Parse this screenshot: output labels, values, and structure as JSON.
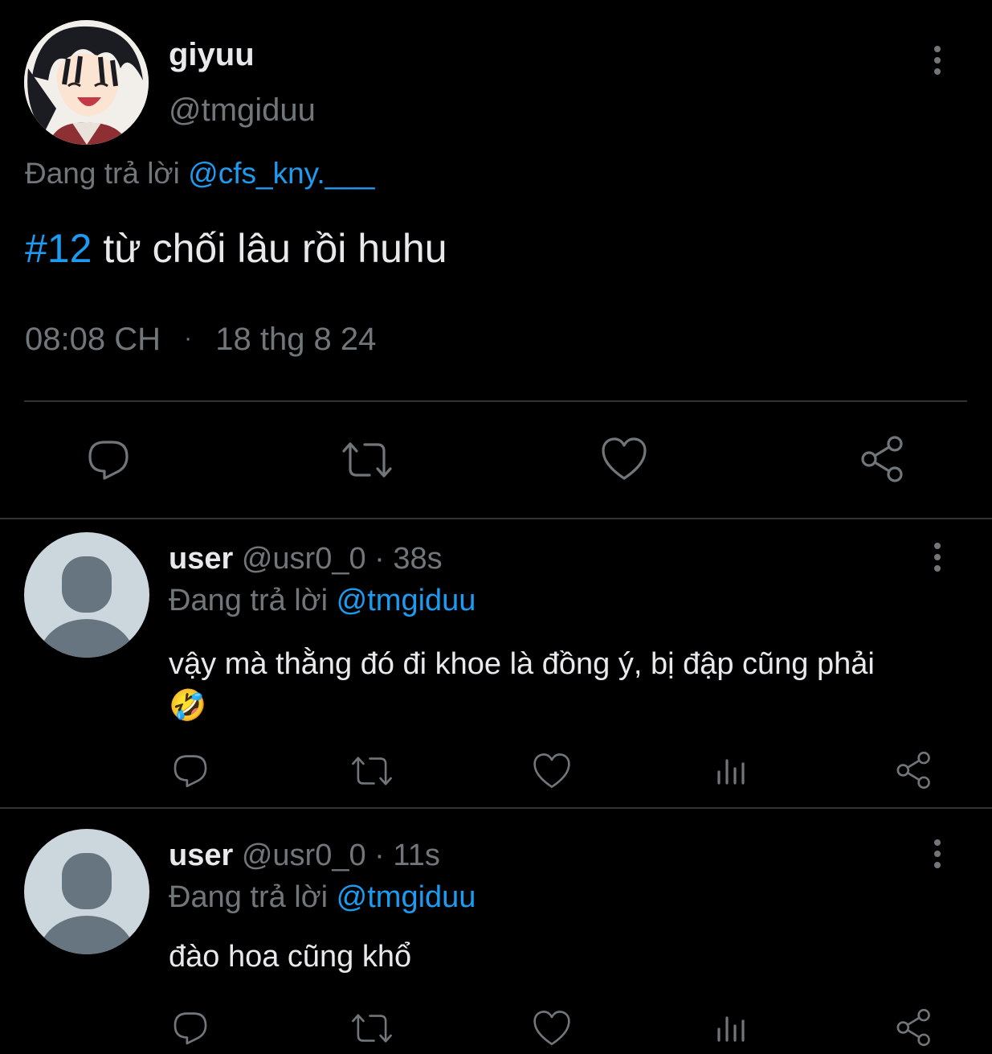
{
  "main_tweet": {
    "display_name": "giyuu",
    "handle": "@tmgiduu",
    "replying_prefix": "Đang trả lời",
    "replying_to": "@cfs_kny.___",
    "hashtag": "#12",
    "text": " từ chối lâu rồi huhu",
    "time": "08:08 CH",
    "separator": "·",
    "date": "18 thg 8 24"
  },
  "replies": [
    {
      "display_name": "user",
      "handle": "@usr0_0",
      "time": "· 38s",
      "replying_prefix": "Đang trả lời",
      "replying_to": "@tmgiduu",
      "text": "vậy mà thằng đó đi khoe là đồng ý, bị đập cũng phải",
      "emoji": "🤣"
    },
    {
      "display_name": "user",
      "handle": "@usr0_0",
      "time": "· 11s",
      "replying_prefix": "Đang trả lời",
      "replying_to": "@tmgiduu",
      "text": "đào hoa cũng khổ"
    }
  ],
  "icons": {
    "reply": "reply-icon",
    "retweet": "retweet-icon",
    "like": "heart-icon",
    "share": "share-icon",
    "views": "views-icon",
    "more": "more-icon"
  },
  "colors": {
    "background": "#000000",
    "text": "#e7e9ea",
    "muted": "#71767b",
    "link": "#1d9bf0",
    "divider": "#2f3336"
  }
}
